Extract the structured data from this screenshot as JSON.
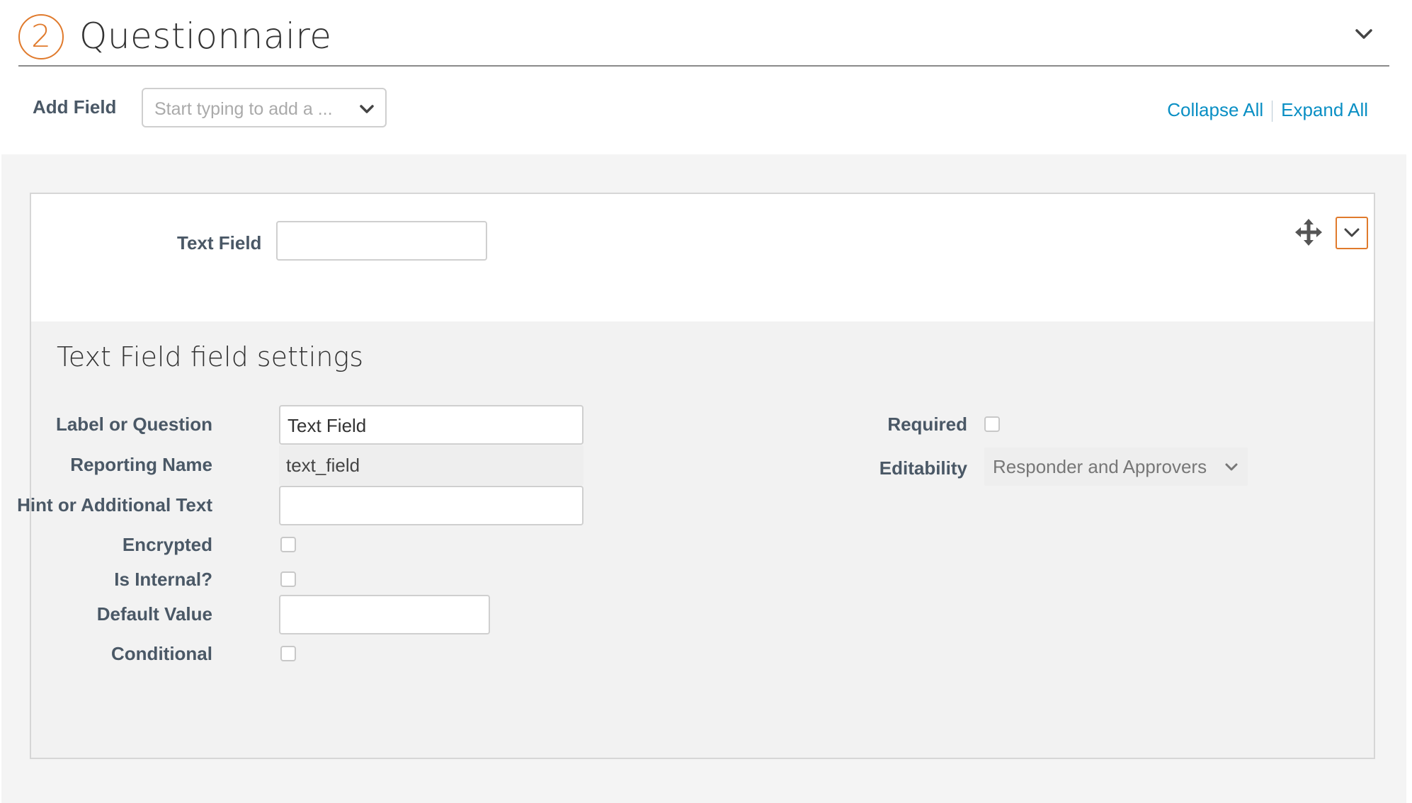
{
  "header": {
    "step_number": "2",
    "title": "Questionnaire",
    "chevron_icon": "chevron-down-icon"
  },
  "toolbar": {
    "add_field_label": "Add Field",
    "add_field_placeholder": "Start typing to add a ...",
    "collapse_all": "Collapse All",
    "expand_all": "Expand All"
  },
  "field_preview": {
    "label": "Text Field",
    "value": "",
    "move_icon": "move-icon",
    "toggle_icon": "chevron-down-icon"
  },
  "settings": {
    "title": "Text Field field settings",
    "label_or_question": {
      "label": "Label or Question",
      "value": "Text Field"
    },
    "reporting_name": {
      "label": "Reporting Name",
      "value": "text_field"
    },
    "hint": {
      "label": "Hint or Additional Text",
      "value": ""
    },
    "encrypted": {
      "label": "Encrypted",
      "checked": false
    },
    "is_internal": {
      "label": "Is Internal?",
      "checked": false
    },
    "default_value": {
      "label": "Default Value",
      "value": ""
    },
    "conditional": {
      "label": "Conditional",
      "checked": false
    },
    "required": {
      "label": "Required",
      "checked": false
    },
    "editability": {
      "label": "Editability",
      "value": "Responder and Approvers"
    }
  },
  "colors": {
    "accent_orange": "#e07a2c",
    "link_blue": "#0a8fc4",
    "label_slate": "#4a5866"
  }
}
